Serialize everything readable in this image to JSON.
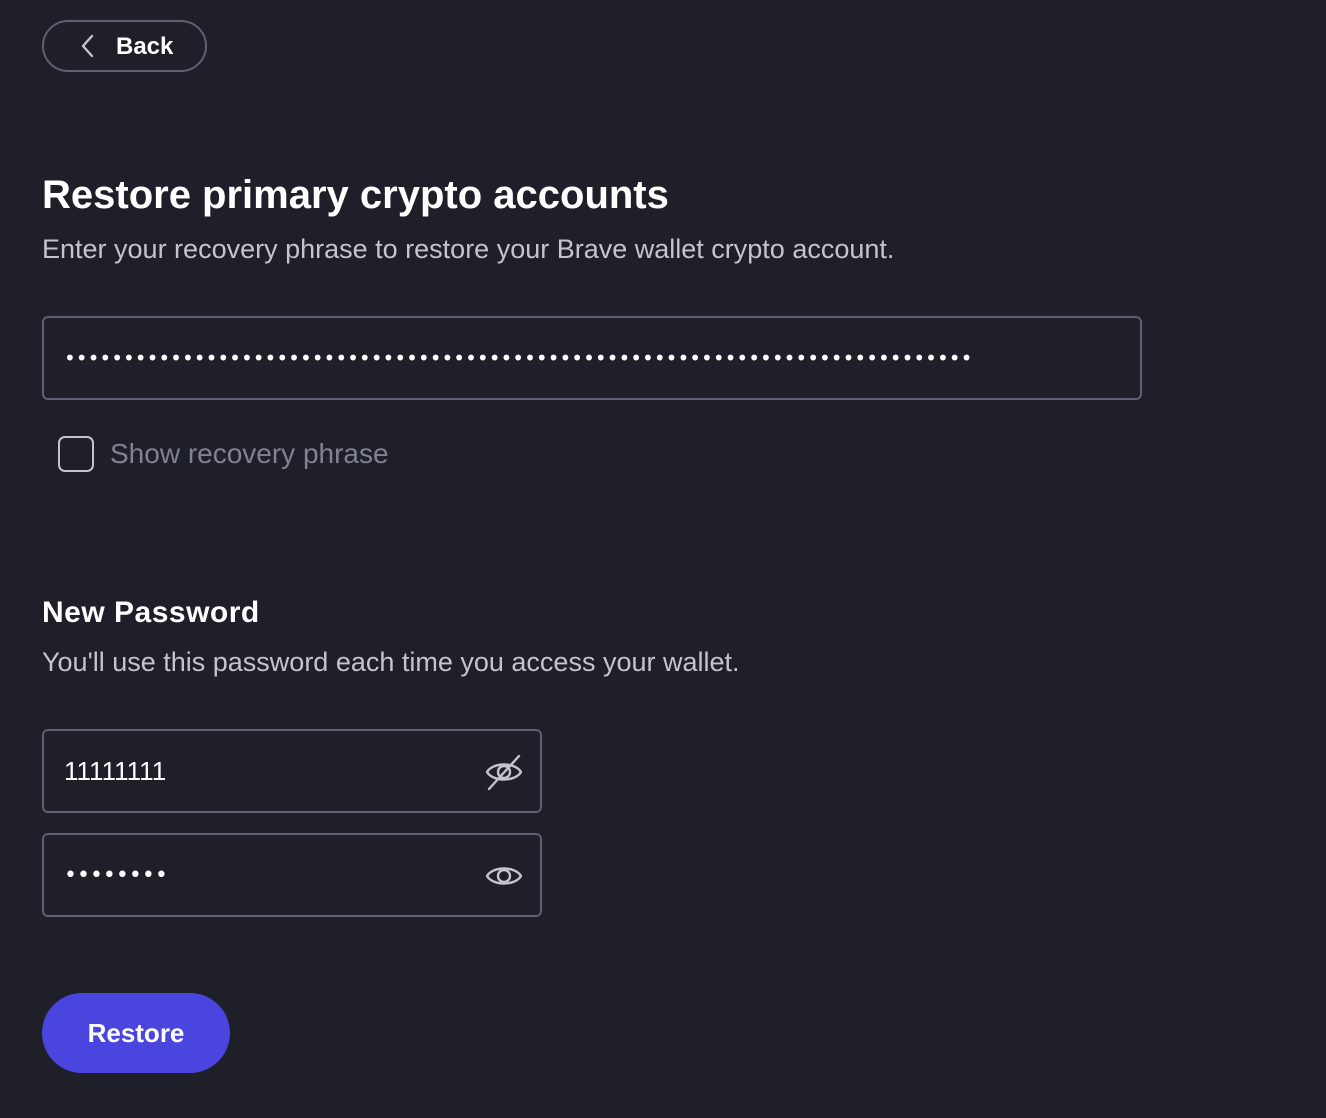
{
  "back": {
    "label": "Back",
    "icon": "chevron-left-icon"
  },
  "header": {
    "title": "Restore primary crypto accounts",
    "subtitle": "Enter your recovery phrase to restore your Brave wallet crypto account."
  },
  "recovery": {
    "masked_value": "•••••••••••••••••••••••••••••••••••••••••••••••••••••••••••••••••••••••••••••",
    "show_label": "Show recovery phrase",
    "show_checked": false
  },
  "password": {
    "title": "New Password",
    "subtitle": "You'll use this password each time you access your wallet.",
    "field_value": "11111111",
    "field_icon": "eye-slash-icon",
    "confirm_masked_value": "••••••••",
    "confirm_icon": "eye-icon"
  },
  "restore": {
    "label": "Restore"
  },
  "colors": {
    "background": "#1e1f29",
    "border": "#5d6072",
    "accent": "#4b45df",
    "muted_text": "#7f8294",
    "secondary_text": "#c2c4cf"
  }
}
